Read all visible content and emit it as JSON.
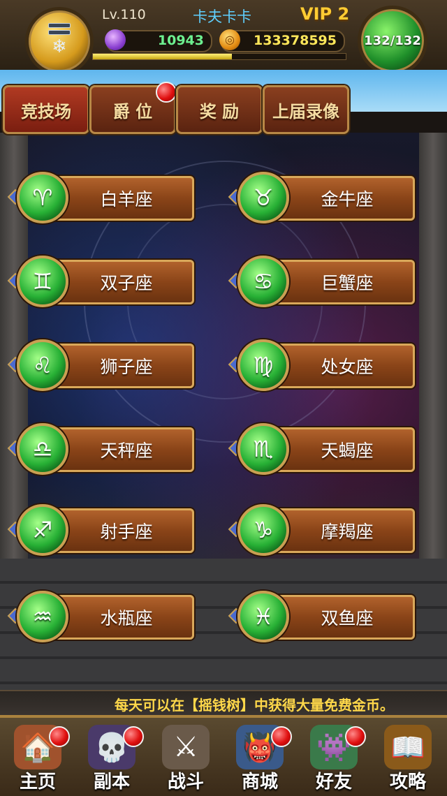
{
  "header": {
    "level": "Lv.110",
    "player_name": "卡夫卡卡",
    "vip": "VIP 2",
    "gems": "10943",
    "coins": "133378595",
    "energy": "132/132",
    "xp_progress": 0.55
  },
  "tabs": [
    {
      "label": "竞技场",
      "active": true,
      "badge": false
    },
    {
      "label": "爵 位",
      "active": false,
      "badge": true
    },
    {
      "label": "奖 励",
      "active": false,
      "badge": false
    },
    {
      "label": "上届录像",
      "active": false,
      "badge": false
    }
  ],
  "signs": [
    {
      "symbol": "♈",
      "label": "白羊座"
    },
    {
      "symbol": "♉",
      "label": "金牛座"
    },
    {
      "symbol": "♊",
      "label": "双子座"
    },
    {
      "symbol": "♋",
      "label": "巨蟹座"
    },
    {
      "symbol": "♌",
      "label": "狮子座"
    },
    {
      "symbol": "♍",
      "label": "处女座"
    },
    {
      "symbol": "♎",
      "label": "天秤座"
    },
    {
      "symbol": "♏",
      "label": "天蝎座"
    },
    {
      "symbol": "♐",
      "label": "射手座"
    },
    {
      "symbol": "♑",
      "label": "摩羯座"
    },
    {
      "symbol": "♒",
      "label": "水瓶座"
    },
    {
      "symbol": "♓",
      "label": "双鱼座"
    }
  ],
  "ticker": "每天可以在【摇钱树】中获得大量免费金币。",
  "nav": [
    {
      "label": "主页",
      "icon": "house-icon",
      "glyph": "🏠",
      "badge": true,
      "color": "#a0522d"
    },
    {
      "label": "副本",
      "icon": "skull-icon",
      "glyph": "💀",
      "badge": true,
      "color": "#4a3a6a"
    },
    {
      "label": "战斗",
      "icon": "sword-icon",
      "glyph": "⚔",
      "badge": false,
      "color": "#6a5a4a"
    },
    {
      "label": "商城",
      "icon": "shop-icon",
      "glyph": "👹",
      "badge": true,
      "color": "#3a5a8a"
    },
    {
      "label": "好友",
      "icon": "friends-icon",
      "glyph": "👾",
      "badge": true,
      "color": "#3a7a4a"
    },
    {
      "label": "攻略",
      "icon": "book-icon",
      "glyph": "📖",
      "badge": false,
      "color": "#8a5a1a"
    }
  ]
}
